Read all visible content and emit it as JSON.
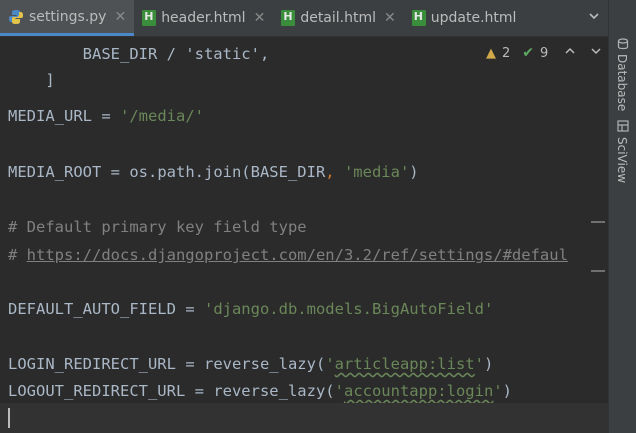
{
  "tabs": [
    {
      "label": "settings.py",
      "icon": "python-icon",
      "active": true
    },
    {
      "label": "header.html",
      "icon": "html-icon",
      "active": false
    },
    {
      "label": "detail.html",
      "icon": "html-icon",
      "active": false
    },
    {
      "label": "update.html",
      "icon": "html-icon",
      "active": false
    }
  ],
  "tabs_menu_icon": "chevron-down-icon",
  "right_tools": [
    {
      "label": "Database",
      "icon": "database-icon"
    },
    {
      "label": "SciView",
      "icon": "sciview-icon"
    }
  ],
  "inspection": {
    "warnings": "2",
    "passes": "9"
  },
  "code": {
    "partial_top": "    BASE_DIR / 'static',",
    "bracket": "]",
    "media_url": {
      "name": "MEDIA_URL",
      "eq": " = ",
      "value": "'/media/'"
    },
    "media_root": {
      "name": "MEDIA_ROOT",
      "eq": " = ",
      "call": "os.path.join(BASE_DIR",
      "comma": ", ",
      "value": "'media'",
      "close": ")"
    },
    "comment1": "# Default primary key field type",
    "comment2_hash": "# ",
    "comment2_link": "https://docs.djangoproject.com/en/3.2/ref/settings/#defaul",
    "default_auto": {
      "name": "DEFAULT_AUTO_FIELD",
      "eq": " = ",
      "value": "'django.db.models.BigAutoField'"
    },
    "login": {
      "name": "LOGIN_REDIRECT_URL",
      "eq": " = ",
      "call": "reverse_lazy(",
      "q1": "'",
      "val": "articleapp:list",
      "q2": "'",
      "close": ")"
    },
    "logout": {
      "name": "LOGOUT_REDIRECT_URL",
      "eq": " = ",
      "call": "reverse_lazy(",
      "q1": "'",
      "val": "accountapp:login",
      "q2": "'",
      "close": ")"
    }
  },
  "colors": {
    "background": "#2b2b2b",
    "string": "#6a8759",
    "comment": "#808080",
    "accent": "#4a88c7"
  }
}
